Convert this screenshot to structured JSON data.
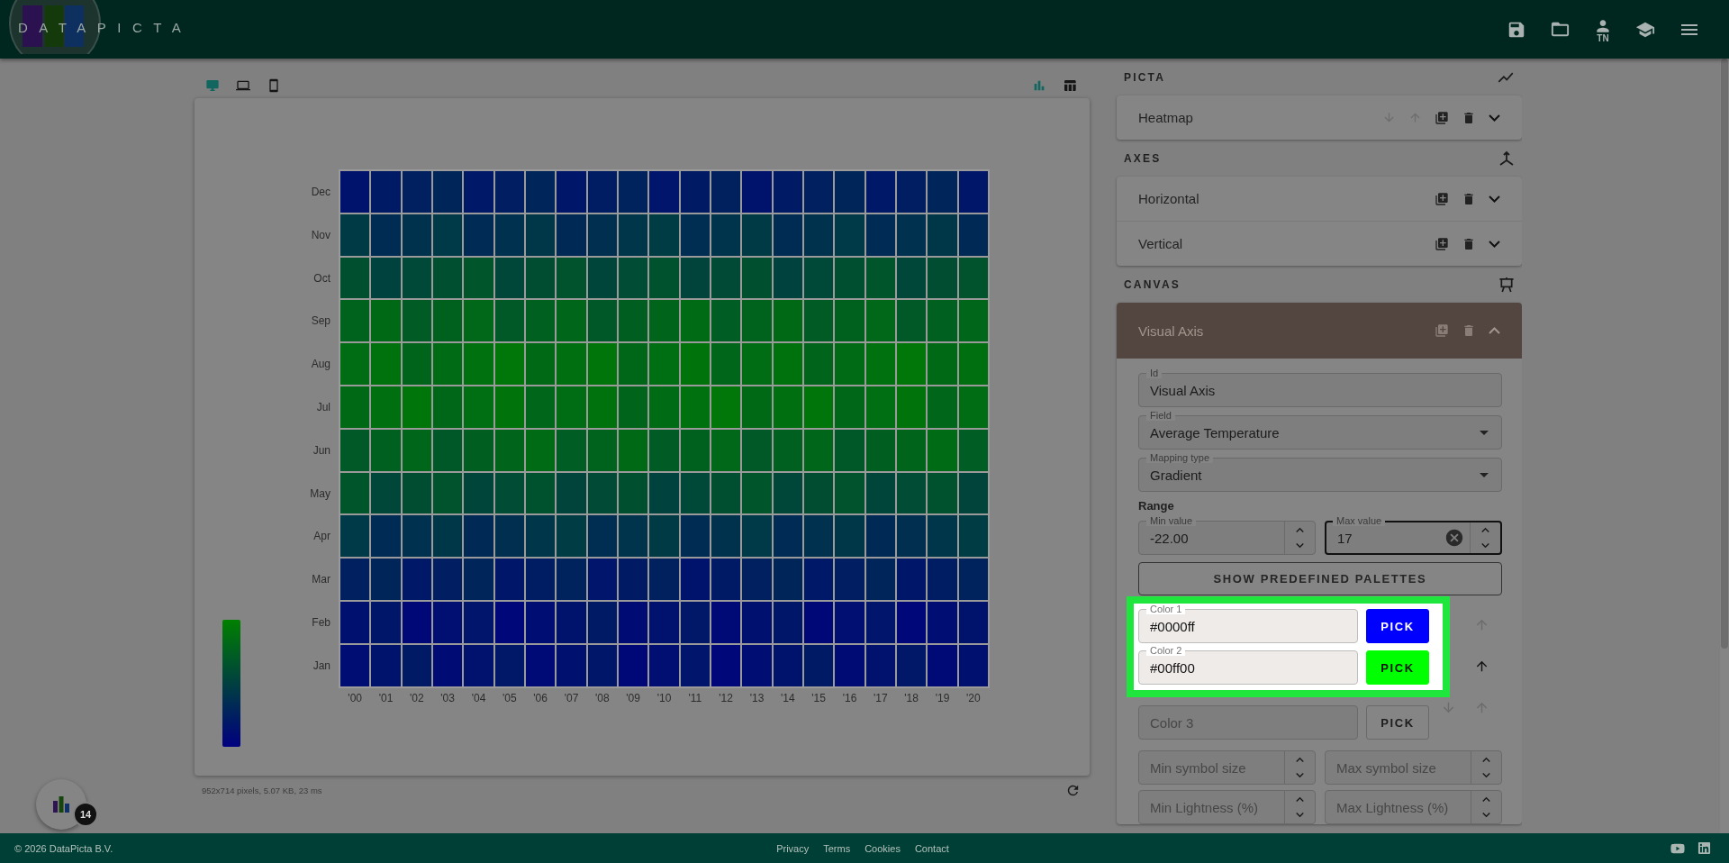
{
  "header": {
    "logo": "DATAPICTA",
    "user_initials": "TN"
  },
  "view_toolbar": {
    "devices": [
      {
        "kind": "desktop",
        "selected": true
      },
      {
        "kind": "laptop",
        "selected": false
      },
      {
        "kind": "phone",
        "selected": false
      }
    ],
    "views": [
      {
        "kind": "chart",
        "selected": true
      },
      {
        "kind": "table",
        "selected": false
      }
    ]
  },
  "heatmap": {
    "rows": [
      "Dec",
      "Nov",
      "Oct",
      "Sep",
      "Aug",
      "Jul",
      "Jun",
      "May",
      "Apr",
      "Mar",
      "Feb",
      "Jan"
    ],
    "columns": [
      "'00",
      "'01",
      "'02",
      "'03",
      "'04",
      "'05",
      "'06",
      "'07",
      "'08",
      "'09",
      "'10",
      "'11",
      "'12",
      "'13",
      "'14",
      "'15",
      "'16",
      "'17",
      "'18",
      "'19",
      "'20"
    ]
  },
  "render_info": "952x714 pixels, 5.07 KB, 23 ms",
  "fab_badge": "14",
  "panel": {
    "sections": [
      {
        "title": "PICTA",
        "items": [
          {
            "label": "Heatmap",
            "reorder": true,
            "selected": false,
            "expanded": false
          }
        ]
      },
      {
        "title": "AXES",
        "items": [
          {
            "label": "Horizontal",
            "reorder": false,
            "selected": false,
            "expanded": false
          },
          {
            "label": "Vertical",
            "reorder": false,
            "selected": false,
            "expanded": false
          }
        ]
      },
      {
        "title": "CANVAS",
        "items": [
          {
            "label": "Visual Axis",
            "reorder": false,
            "selected": true,
            "expanded": true
          }
        ]
      }
    ]
  },
  "editor": {
    "id_field": {
      "label": "Id",
      "value": "Visual Axis"
    },
    "field_select": {
      "label": "Field",
      "value": "Average Temperature"
    },
    "mapping_select": {
      "label": "Mapping type",
      "value": "Gradient"
    },
    "range_label": "Range",
    "min_value": {
      "label": "Min value",
      "value": "-22.00",
      "focused": false,
      "clearable": false
    },
    "max_value": {
      "label": "Max value",
      "value": "17",
      "focused": true,
      "clearable": true
    },
    "palettes_button": "SHOW PREDEFINED PALETTES",
    "colors": [
      {
        "label": "Color 1",
        "value": "#0000ff",
        "color": "#0000ff",
        "pick_label": "PICK",
        "highlighted": true,
        "arrows": [
          {
            "kind": "up",
            "disabled": true
          }
        ]
      },
      {
        "label": "Color 2",
        "value": "#00ff00",
        "color": "#00ff00",
        "pick_label": "PICK",
        "highlighted": true,
        "arrows": [
          {
            "kind": "up",
            "disabled": false
          }
        ]
      },
      {
        "placeholder": "Color 3",
        "pick_label": "PICK",
        "highlighted": false,
        "arrows": [
          {
            "kind": "down",
            "disabled": true
          },
          {
            "kind": "up",
            "disabled": true
          }
        ]
      }
    ],
    "number_pairs": [
      [
        {
          "placeholder": "Min symbol size"
        },
        {
          "placeholder": "Max symbol size"
        }
      ],
      [
        {
          "placeholder": "Min Lightness (%)"
        },
        {
          "placeholder": "Max Lightness (%)"
        }
      ]
    ]
  },
  "footer": {
    "copyright": "© 2026 DataPicta B.V.",
    "links": [
      "Privacy",
      "Terms",
      "Cookies",
      "Contact"
    ]
  }
}
